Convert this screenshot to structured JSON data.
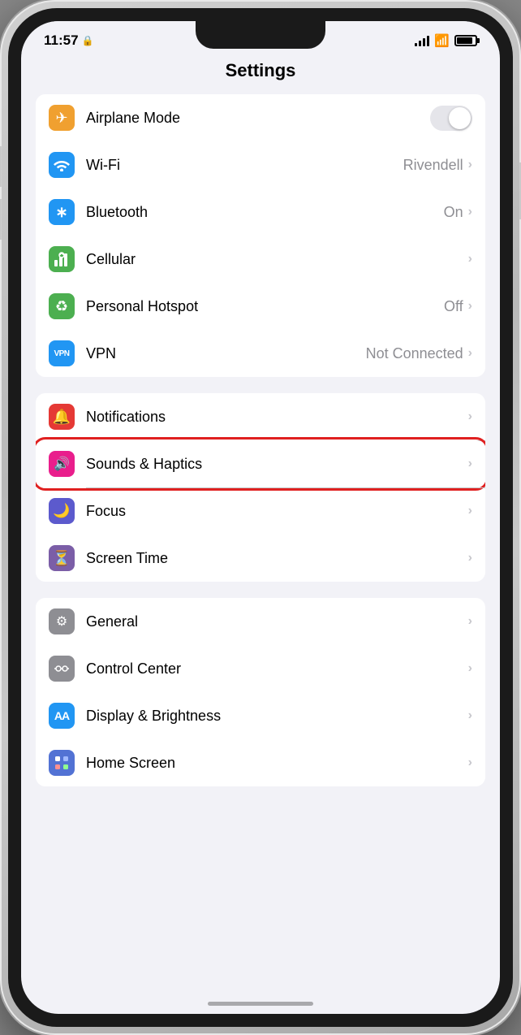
{
  "statusBar": {
    "time": "11:57",
    "lockIcon": "🔒"
  },
  "pageTitle": "Settings",
  "groups": [
    {
      "id": "connectivity",
      "rows": [
        {
          "id": "airplane-mode",
          "label": "Airplane Mode",
          "iconBg": "#f0a030",
          "iconSymbol": "✈",
          "valueType": "toggle",
          "toggleOn": false,
          "value": ""
        },
        {
          "id": "wifi",
          "label": "Wi-Fi",
          "iconBg": "#2196f3",
          "iconSymbol": "wifi",
          "valueType": "text",
          "value": "Rivendell"
        },
        {
          "id": "bluetooth",
          "label": "Bluetooth",
          "iconBg": "#2196f3",
          "iconSymbol": "bt",
          "valueType": "text",
          "value": "On"
        },
        {
          "id": "cellular",
          "label": "Cellular",
          "iconBg": "#4caf50",
          "iconSymbol": "cell",
          "valueType": "text",
          "value": ""
        },
        {
          "id": "hotspot",
          "label": "Personal Hotspot",
          "iconBg": "#4caf50",
          "iconSymbol": "hotspot",
          "valueType": "text",
          "value": "Off"
        },
        {
          "id": "vpn",
          "label": "VPN",
          "iconBg": "#2196f3",
          "iconSymbol": "VPN",
          "iconBgVpn": true,
          "valueType": "text",
          "value": "Not Connected"
        }
      ]
    },
    {
      "id": "notifications",
      "rows": [
        {
          "id": "notifications",
          "label": "Notifications",
          "iconBg": "#e53935",
          "iconSymbol": "bell",
          "valueType": "text",
          "value": ""
        },
        {
          "id": "sounds",
          "label": "Sounds & Haptics",
          "iconBg": "#e91e8c",
          "iconSymbol": "speaker",
          "valueType": "text",
          "value": "",
          "highlighted": true
        },
        {
          "id": "focus",
          "label": "Focus",
          "iconBg": "#5c5acd",
          "iconSymbol": "moon",
          "valueType": "text",
          "value": ""
        },
        {
          "id": "screentime",
          "label": "Screen Time",
          "iconBg": "#7b5ea7",
          "iconSymbol": "hourglass",
          "valueType": "text",
          "value": ""
        }
      ]
    },
    {
      "id": "general",
      "rows": [
        {
          "id": "general",
          "label": "General",
          "iconBg": "#8e8e93",
          "iconSymbol": "gear",
          "valueType": "text",
          "value": ""
        },
        {
          "id": "control-center",
          "label": "Control Center",
          "iconBg": "#8e8e93",
          "iconSymbol": "sliders",
          "valueType": "text",
          "value": ""
        },
        {
          "id": "display",
          "label": "Display & Brightness",
          "iconBg": "#2196f3",
          "iconSymbol": "AA",
          "valueType": "text",
          "value": ""
        },
        {
          "id": "homescreen",
          "label": "Home Screen",
          "iconBg": "#5272d4",
          "iconSymbol": "grid",
          "valueType": "text",
          "value": ""
        }
      ]
    }
  ],
  "homeIndicator": true
}
